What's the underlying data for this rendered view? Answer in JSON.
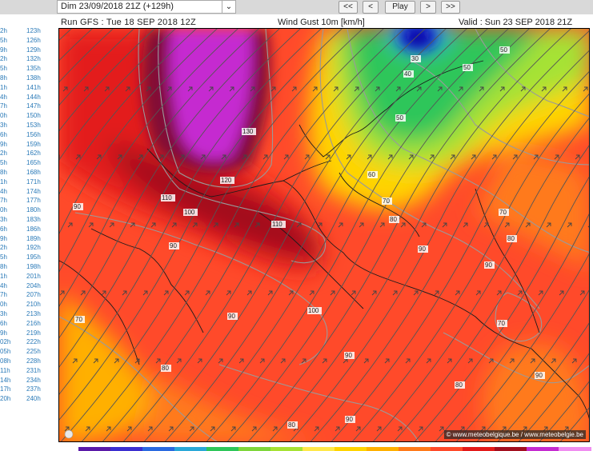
{
  "controls": {
    "time_select": "Dim 23/09/2018 21Z (+129h)",
    "first": "<<",
    "prev": "<",
    "play": "Play",
    "next": ">",
    "last": ">>"
  },
  "hours_col1": [
    "2h",
    "5h",
    "9h",
    "2h",
    "5h",
    "8h",
    "1h",
    "4h",
    "7h",
    "0h",
    "3h",
    "6h",
    "9h",
    "2h",
    "5h",
    "8h",
    "1h",
    "4h",
    "7h",
    "0h",
    "3h",
    "6h",
    "9h",
    "2h",
    "5h",
    "8h",
    "1h",
    "4h",
    "7h",
    "0h",
    "3h",
    "6h",
    "9h",
    "02h",
    "05h",
    "08h",
    "11h",
    "14h",
    "17h",
    "20h"
  ],
  "hours_col2": [
    "123h",
    "126h",
    "129h",
    "132h",
    "135h",
    "138h",
    "141h",
    "144h",
    "147h",
    "150h",
    "153h",
    "156h",
    "159h",
    "162h",
    "165h",
    "168h",
    "171h",
    "174h",
    "177h",
    "180h",
    "183h",
    "186h",
    "189h",
    "192h",
    "195h",
    "198h",
    "201h",
    "204h",
    "207h",
    "210h",
    "213h",
    "216h",
    "219h",
    "222h",
    "225h",
    "228h",
    "231h",
    "234h",
    "237h",
    "240h"
  ],
  "map": {
    "run": "Run GFS : Tue 18 SEP 2018 12Z",
    "parameter": "Wind Gust 10m [km/h]",
    "valid": "Valid : Sun 23 SEP 2018 21Z",
    "credit": "© www.meteobelgique.be / www.meteobelgie.be",
    "isoline_labels": [
      "130",
      "120",
      "110",
      "100",
      "90",
      "110",
      "90",
      "100",
      "90",
      "80",
      "70",
      "30",
      "40",
      "50",
      "50",
      "50",
      "60",
      "70",
      "80",
      "90",
      "90",
      "70",
      "80",
      "90",
      "90",
      "80",
      "90",
      "80",
      "70"
    ]
  },
  "colors": {
    "toolbar": "#d9d9d9",
    "gust_10_20": "#3b2fd0",
    "gust_40": "#2ec65a",
    "gust_50": "#a6e234",
    "gust_60": "#ffd400",
    "gust_70": "#ffb000",
    "gust_80": "#ff7a1a",
    "gust_90": "#ff4a2a",
    "gust_100": "#e31a1a",
    "gust_110": "#a30f1f",
    "gust_120": "#820a35",
    "gust_130": "#c52bd0"
  }
}
